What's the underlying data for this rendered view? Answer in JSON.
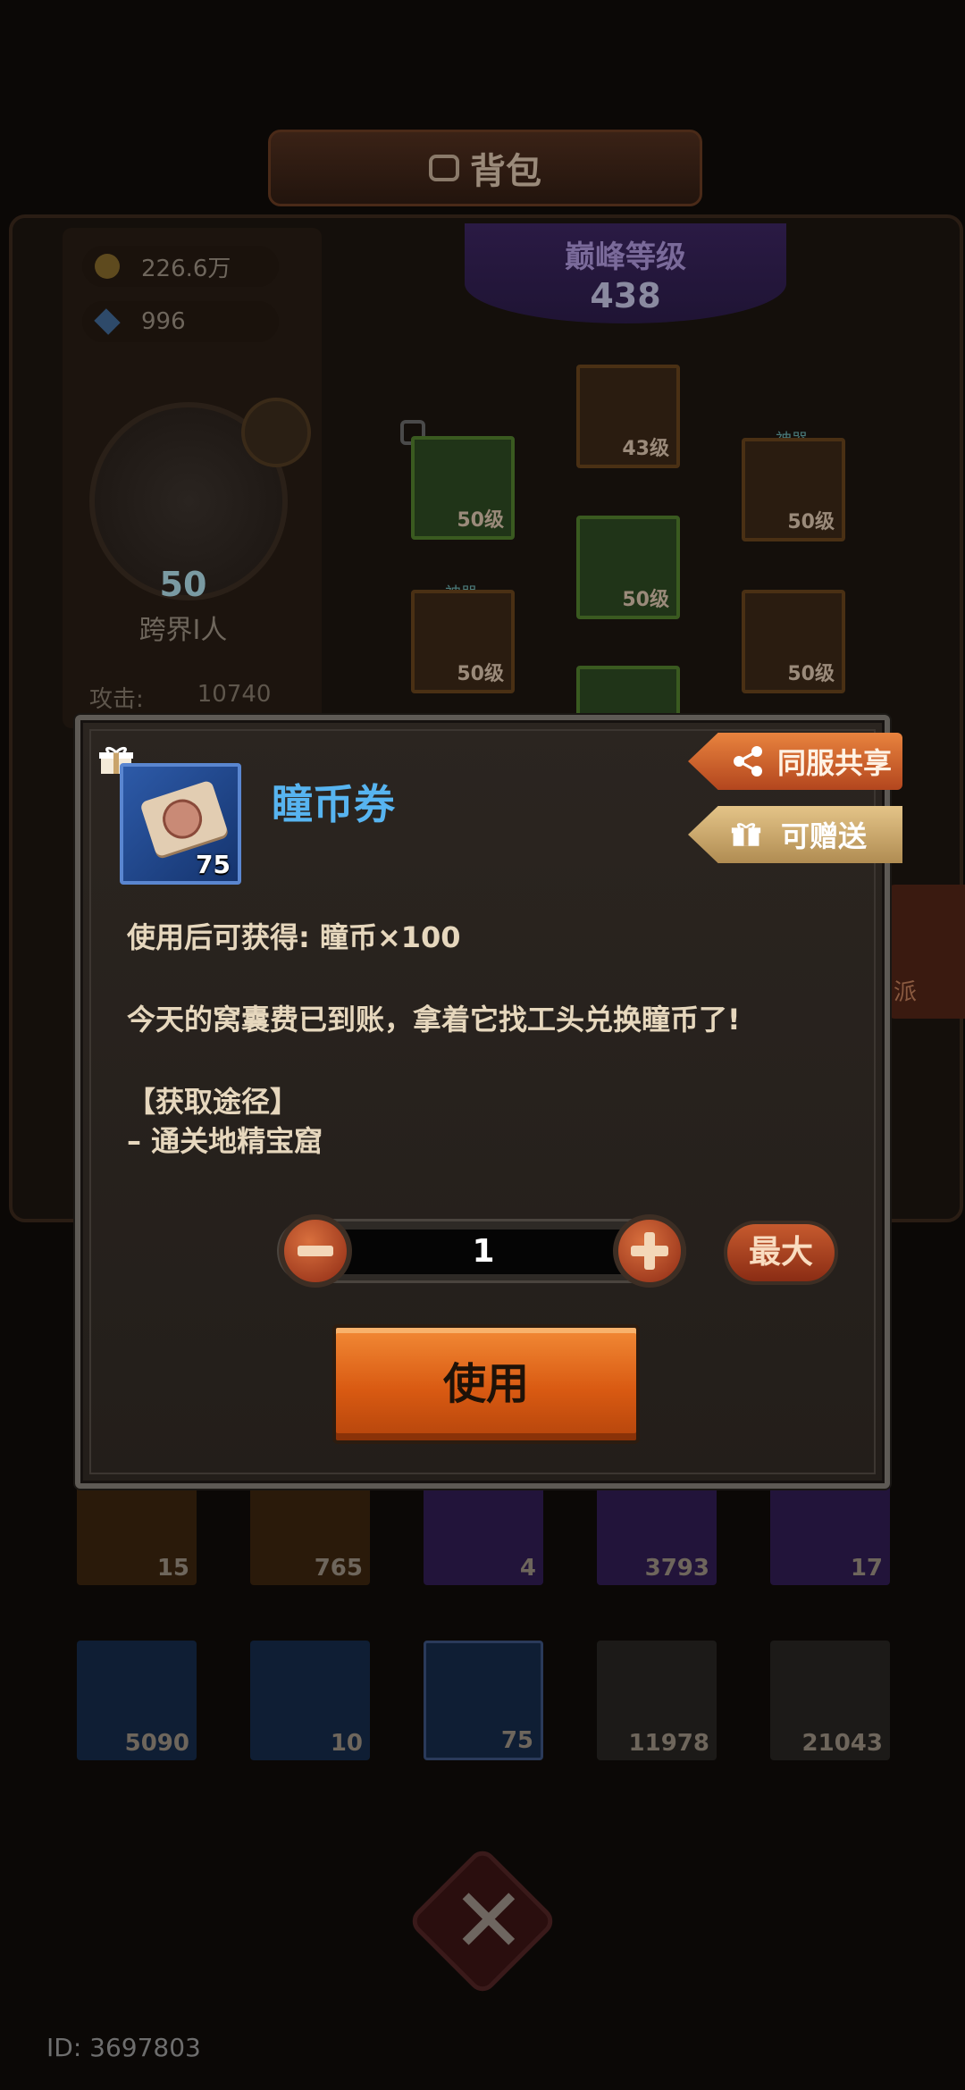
{
  "header": {
    "title": "背包"
  },
  "currency": {
    "gold": "226.6万",
    "gems": "996"
  },
  "player": {
    "level": "50",
    "name": "跨界I人",
    "attack_label": "攻击:",
    "attack_value": "10740"
  },
  "peak": {
    "label": "巅峰等级",
    "value": "438"
  },
  "equipment": [
    {
      "level": "43级"
    },
    {
      "level": "50级"
    },
    {
      "level": "50级",
      "tag": "神器"
    },
    {
      "level": "50级"
    },
    {
      "level": "50级",
      "tag": "神器"
    },
    {
      "level": "50级"
    }
  ],
  "side_tab": {
    "label": "派"
  },
  "inventory_row1": [
    "15",
    "765",
    "4",
    "3793",
    "17"
  ],
  "inventory_row2": [
    "5090",
    "10",
    "75",
    "11978",
    "21043"
  ],
  "modal": {
    "item_name": "瞳币券",
    "item_count": "75",
    "share_label": "同服共享",
    "gift_label": "可赠送",
    "use_effect": "使用后可获得: 瞳币×100",
    "flavor": "今天的窝囊费已到账，拿着它找工头兑换瞳币了!",
    "source_title": "【获取途径】",
    "source_line": "– 通关地精宝窟",
    "quantity": "1",
    "max_label": "最大",
    "use_label": "使用"
  },
  "footer": {
    "id_text": "ID: 3697803"
  },
  "colors": {
    "accent_orange": "#e0661c",
    "item_name_blue": "#57b4f0",
    "modal_bg": "#2b2520"
  },
  "icons": [
    "bag-icon",
    "gold-coin-icon",
    "gem-icon",
    "gift-icon",
    "share-icon",
    "minus-icon",
    "plus-icon",
    "close-icon"
  ]
}
